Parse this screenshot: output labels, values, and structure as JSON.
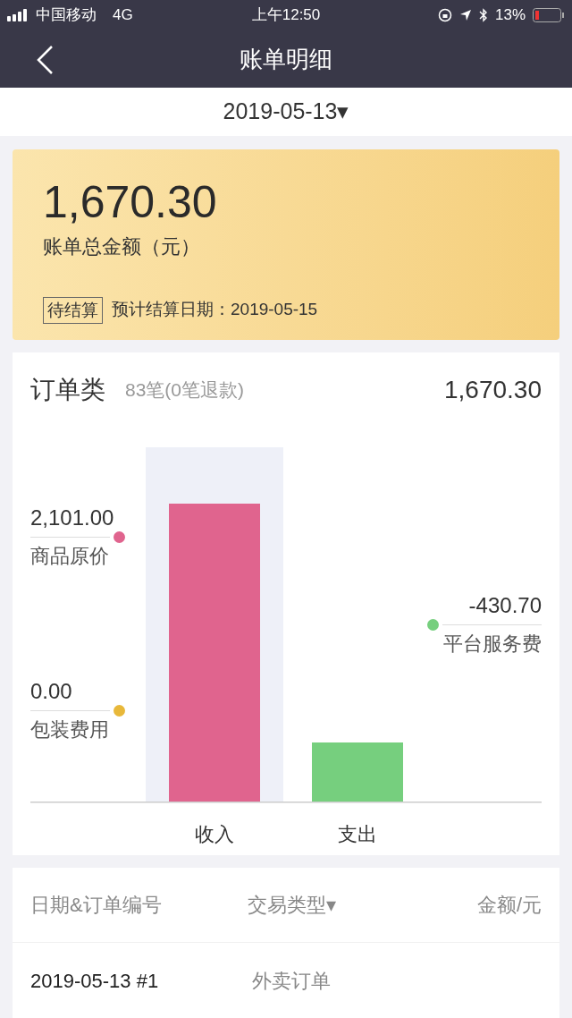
{
  "status_bar": {
    "carrier": "中国移动",
    "network": "4G",
    "time": "上午12:50",
    "battery": "13%"
  },
  "nav": {
    "title": "账单明细"
  },
  "date_picker": {
    "value": "2019-05-13",
    "caret": "▾"
  },
  "summary": {
    "amount": "1,670.30",
    "label": "账单总金额（元）",
    "tag": "待结算",
    "settlement": "预计结算日期：2019-05-15"
  },
  "orders": {
    "title": "订单类",
    "count": "83笔(0笔退款)",
    "total": "1,670.30",
    "labels": [
      {
        "value": "2,101.00",
        "name": "商品原价",
        "color": "#e0648e",
        "kind": "income"
      },
      {
        "value": "0.00",
        "name": "包装费用",
        "color": "#e8b83a",
        "kind": "income"
      },
      {
        "value": "-430.70",
        "name": "平台服务费",
        "color": "#76cf7e",
        "kind": "expense"
      }
    ],
    "axis": [
      "收入",
      "支出"
    ]
  },
  "table": {
    "columns": [
      {
        "label": "日期&订单编号"
      },
      {
        "label": "交易类型",
        "caret": "▾"
      },
      {
        "label": "金额/元"
      }
    ],
    "rows": [
      {
        "date": "2019-05-13 #1",
        "type": "外卖订单"
      }
    ]
  }
}
